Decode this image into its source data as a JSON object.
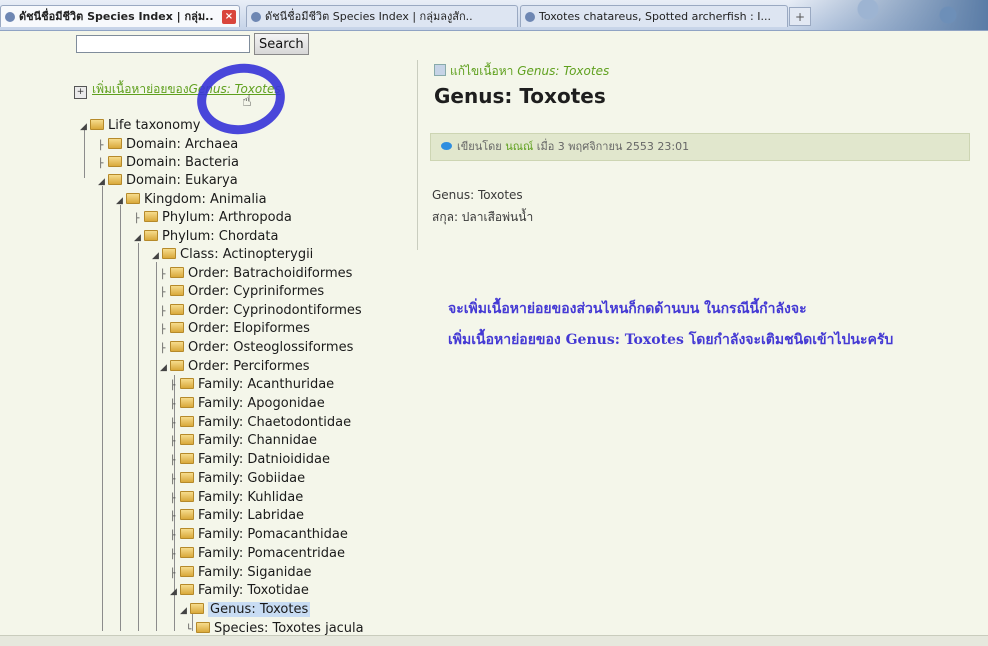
{
  "tabs": [
    {
      "label": "ดัชนีชื่อมีชีวิต Species Index | กลุ่ม..",
      "active": true
    },
    {
      "label": "ดัชนีชื่อมีชีวิต Species Index | กลุ่มลงูสัก..",
      "active": false
    },
    {
      "label": "Toxotes chatareus, Spotted archerfish : I...",
      "active": false
    }
  ],
  "search": {
    "button_label": "Search",
    "value": ""
  },
  "add_child": {
    "prefix": "เพิ่มเนื้อหาย่อยของ",
    "target": "Genus: Toxotes"
  },
  "tree": [
    {
      "label": "Life taxonomy"
    },
    {
      "label": "Domain: Archaea"
    },
    {
      "label": "Domain: Bacteria"
    },
    {
      "label": "Domain: Eukarya"
    },
    {
      "label": "Kingdom: Animalia"
    },
    {
      "label": "Phylum: Arthropoda"
    },
    {
      "label": "Phylum: Chordata"
    },
    {
      "label": "Class: Actinopterygii"
    },
    {
      "label": "Order: Batrachoidiformes"
    },
    {
      "label": "Order: Cypriniformes"
    },
    {
      "label": "Order: Cyprinodontiformes"
    },
    {
      "label": "Order: Elopiformes"
    },
    {
      "label": "Order: Osteoglossiformes"
    },
    {
      "label": "Order: Perciformes"
    },
    {
      "label": "Family: Acanthuridae"
    },
    {
      "label": "Family: Apogonidae"
    },
    {
      "label": "Family: Chaetodontidae"
    },
    {
      "label": "Family: Channidae"
    },
    {
      "label": "Family: Datnioididae"
    },
    {
      "label": "Family: Gobiidae"
    },
    {
      "label": "Family: Kuhlidae"
    },
    {
      "label": "Family: Labridae"
    },
    {
      "label": "Family: Pomacanthidae"
    },
    {
      "label": "Family: Pomacentridae"
    },
    {
      "label": "Family: Siganidae"
    },
    {
      "label": "Family: Toxotidae"
    },
    {
      "label": "Genus: Toxotes",
      "selected": true
    },
    {
      "label": "Species: Toxotes jacula"
    }
  ],
  "edit_link": {
    "prefix": "แก้ไขเนื้อหา",
    "target": "Genus: Toxotes"
  },
  "page_title": "Genus: Toxotes",
  "meta": {
    "by": "เขียนโดย",
    "author": "นณณ์",
    "when": "เมื่อ 3 พฤศจิกายน 2553 23:01"
  },
  "content": [
    "Genus: Toxotes",
    "สกุล: ปลาเสือพ่นน้ำ"
  ],
  "annotation": [
    "จะเพิ่มเนื้อหาย่อยของส่วนไหนก็กดด้านบน ในกรณีนี้กำลังจะ",
    "เพิ่มเนื้อหาย่อยของ Genus: Toxotes โดยกำลังจะเติมชนิดเข้าไปนะครับ"
  ],
  "colors": {
    "link": "#5fa01e",
    "annotation": "#4439d4",
    "highlight_circle": "#3a36d8"
  }
}
